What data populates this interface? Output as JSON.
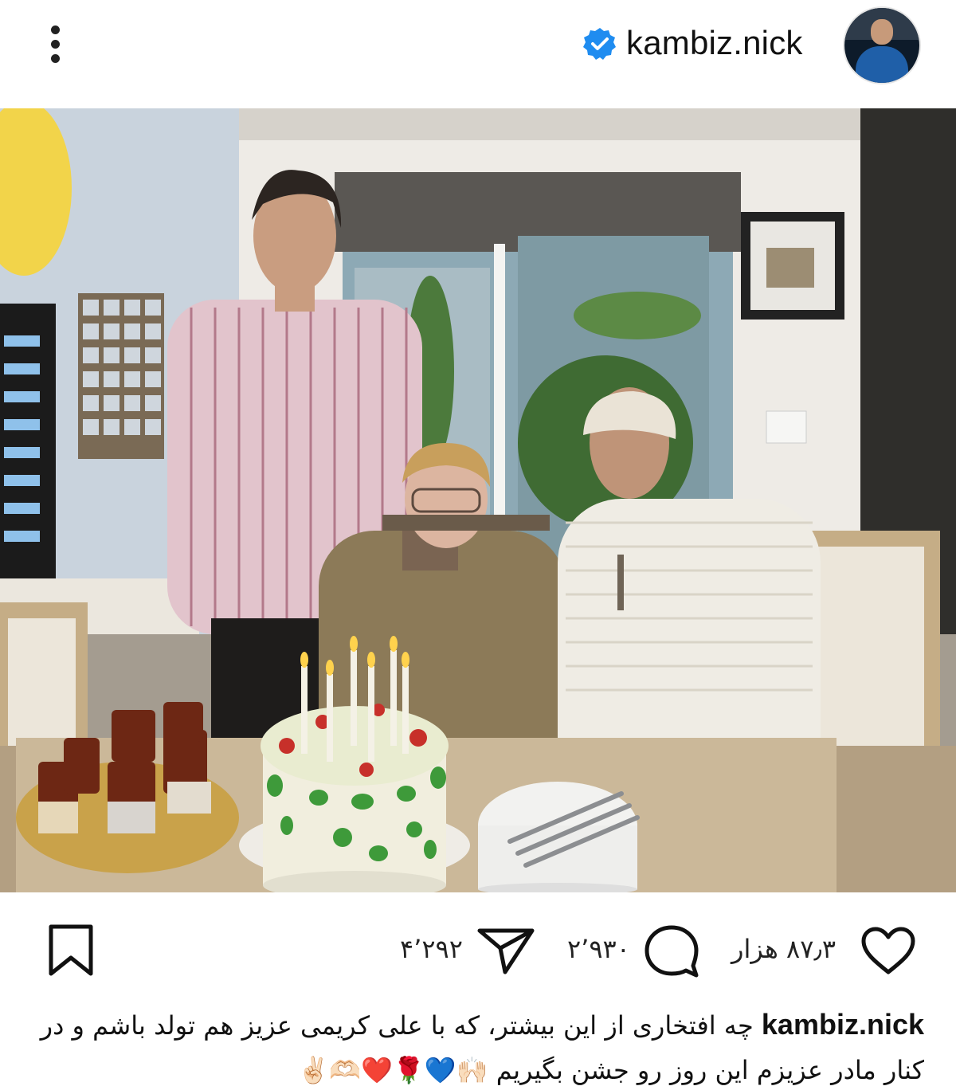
{
  "header": {
    "username": "kambiz.nick",
    "verified": true,
    "more_icon": "more-vertical-icon",
    "avatar_icon": "profile-avatar"
  },
  "post": {
    "image_description_icon": "photo",
    "colors": {
      "verified": "#1f8cf0",
      "text": "#111111"
    }
  },
  "actions": {
    "like_icon": "heart-icon",
    "likes": "۸۷٫۳ هزار",
    "comment_icon": "comment-icon",
    "comments": "۲٬۹۳۰",
    "share_icon": "send-icon",
    "shares": "۴٬۲۹۲",
    "save_icon": "bookmark-icon"
  },
  "caption": {
    "username": "kambiz.nick",
    "text": "چه افتخاری از این بیشتر، که با علی کریمی عزیز هم تولد باشم و در کنار مادر عزیزم این روز رو جشن بگیریم",
    "emojis": "🙌🏻💙🌹❤️🫶🏻✌🏻"
  }
}
